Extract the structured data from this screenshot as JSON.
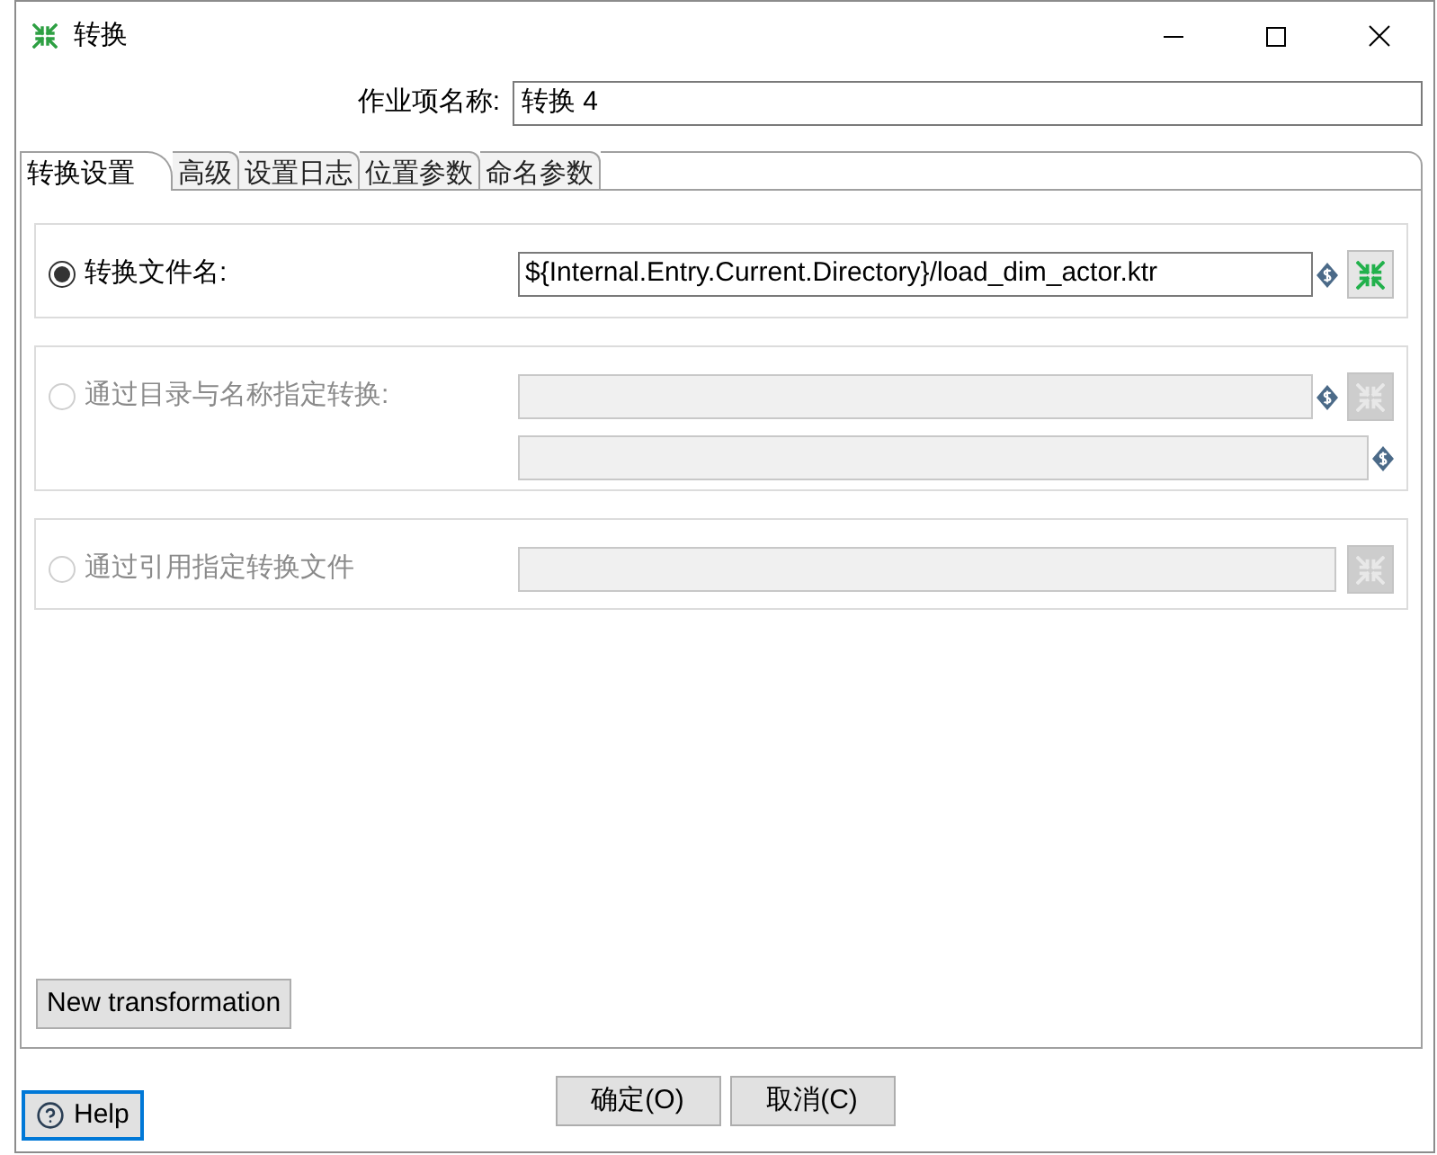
{
  "window": {
    "title": "转换"
  },
  "job_name": {
    "label": "作业项名称:",
    "value": "转换 4"
  },
  "tabs": [
    {
      "label": "转换设置",
      "selected": true
    },
    {
      "label": "高级",
      "selected": false
    },
    {
      "label": "设置日志",
      "selected": false
    },
    {
      "label": "位置参数",
      "selected": false
    },
    {
      "label": "命名参数",
      "selected": false
    }
  ],
  "options": [
    {
      "label": "转换文件名:",
      "selected": true,
      "disabled": false,
      "fields": [
        {
          "kind": "variable_browse",
          "value": "${Internal.Entry.Current.Directory}/load_dim_actor.ktr"
        }
      ]
    },
    {
      "label": "通过目录与名称指定转换:",
      "selected": false,
      "disabled": true,
      "fields": [
        {
          "kind": "variable_browse"
        },
        {
          "kind": "variable"
        }
      ]
    },
    {
      "label": "通过引用指定转换文件",
      "selected": false,
      "disabled": true,
      "fields": [
        {
          "kind": "browse"
        }
      ]
    }
  ],
  "new_button": "New transformation",
  "help": {
    "label": "Help",
    "focused": true
  },
  "buttons": [
    "确定(O)",
    "取消(C)"
  ]
}
